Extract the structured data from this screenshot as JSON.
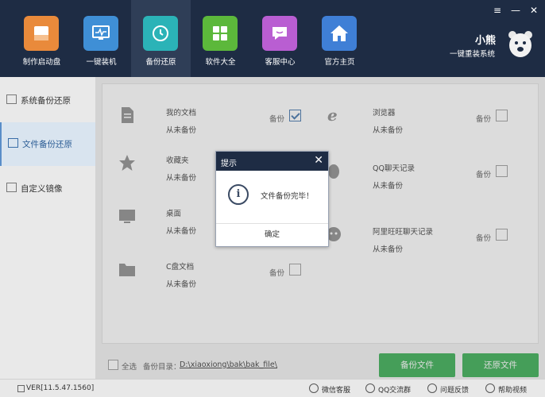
{
  "window": {
    "controls": [
      "≡",
      "—",
      "✕"
    ]
  },
  "colors": {
    "header_bg": "#1e2c44",
    "accent_green": "#2fa94a",
    "accent_blue": "#3a6ea8"
  },
  "header": {
    "nav": [
      {
        "label": "制作启动盘",
        "icon": "usb-drive-icon",
        "color": "#e98a3b"
      },
      {
        "label": "一键装机",
        "icon": "monitor-icon",
        "color": "#3f8fd6"
      },
      {
        "label": "备份还原",
        "icon": "restore-icon",
        "color": "#2bb3b7"
      },
      {
        "label": "软件大全",
        "icon": "apps-grid-icon",
        "color": "#5cb83b"
      },
      {
        "label": "客服中心",
        "icon": "chat-bubble-icon",
        "color": "#b95ed2"
      },
      {
        "label": "官方主页",
        "icon": "home-icon",
        "color": "#3f7fd6"
      }
    ],
    "brand": {
      "name": "小熊",
      "slogan": "一键重装系统"
    }
  },
  "sidebar": {
    "items": [
      {
        "label": "系统备份还原",
        "active": false
      },
      {
        "label": "文件备份还原",
        "active": true
      },
      {
        "label": "自定义镜像",
        "active": false
      }
    ]
  },
  "items": [
    {
      "name": "我的文档",
      "status": "从未备份",
      "backup_label": "备份",
      "checked": true,
      "icon": "document-icon"
    },
    {
      "name": "浏览器",
      "status": "从未备份",
      "backup_label": "备份",
      "checked": false,
      "icon": "ie-browser-icon"
    },
    {
      "name": "收藏夹",
      "status": "从未备份",
      "backup_label": "",
      "checked": false,
      "icon": "star-icon"
    },
    {
      "name": "QQ聊天记录",
      "status": "从未备份",
      "backup_label": "备份",
      "checked": false,
      "icon": "qq-icon"
    },
    {
      "name": "桌面",
      "status": "从未备份",
      "backup_label": "",
      "checked": false,
      "icon": "desktop-icon"
    },
    {
      "name": "阿里旺旺聊天记录",
      "status": "从未备份",
      "backup_label": "备份",
      "checked": false,
      "icon": "wangwang-icon"
    },
    {
      "name": "C盘文档",
      "status": "从未备份",
      "backup_label": "备份",
      "checked": false,
      "icon": "folder-icon"
    }
  ],
  "bottom": {
    "select_all": "全选",
    "dir_label": "备份目录：",
    "dir_path": "D:\\xiaoxiong\\bak\\bak_file\\",
    "backup_btn": "备份文件",
    "restore_btn": "还原文件"
  },
  "status_bar": {
    "version": "VER[11.5.47.1560]",
    "links": [
      "微信客服",
      "QQ交流群",
      "问题反馈",
      "帮助视频"
    ]
  },
  "dialog": {
    "title": "提示",
    "message": "文件备份完毕！",
    "ok": "确定",
    "close": "✕"
  }
}
